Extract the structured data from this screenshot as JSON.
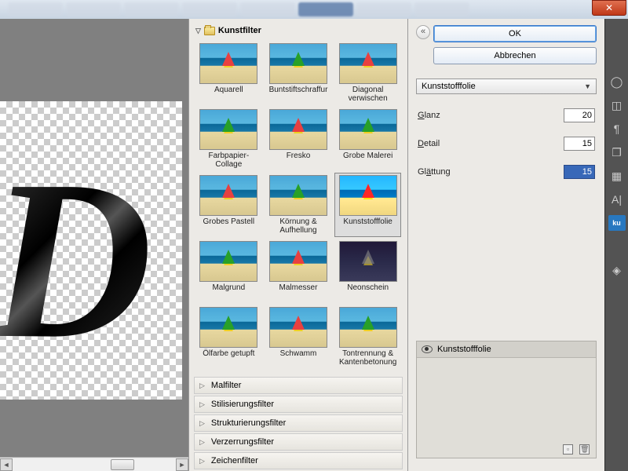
{
  "buttons": {
    "ok": "OK",
    "cancel": "Abbrechen"
  },
  "selected_filter": "Kunststofffolie",
  "params": {
    "glanz": {
      "label": "Glanz",
      "value": "20"
    },
    "detail": {
      "label": "Detail",
      "value": "15"
    },
    "glaettung": {
      "label": "Glättung",
      "value": "15"
    }
  },
  "category_expanded": "Kunstfilter",
  "filters": [
    "Aquarell",
    "Buntstiftschraffur",
    "Diagonal verwischen",
    "Farbpapier-Collage",
    "Fresko",
    "Grobe Malerei",
    "Grobes Pastell",
    "Körnung & Aufhellung",
    "Kunststofffolie",
    "Malgrund",
    "Malmesser",
    "Neonschein",
    "Ölfarbe getupft",
    "Schwamm",
    "Tontrennung & Kantenbetonung"
  ],
  "categories_collapsed": [
    "Malfilter",
    "Stilisierungsfilter",
    "Strukturierungsfilter",
    "Verzerrungsfilter",
    "Zeichenfilter"
  ],
  "layer_name": "Kunststofffolie",
  "canvas_letter": "D"
}
